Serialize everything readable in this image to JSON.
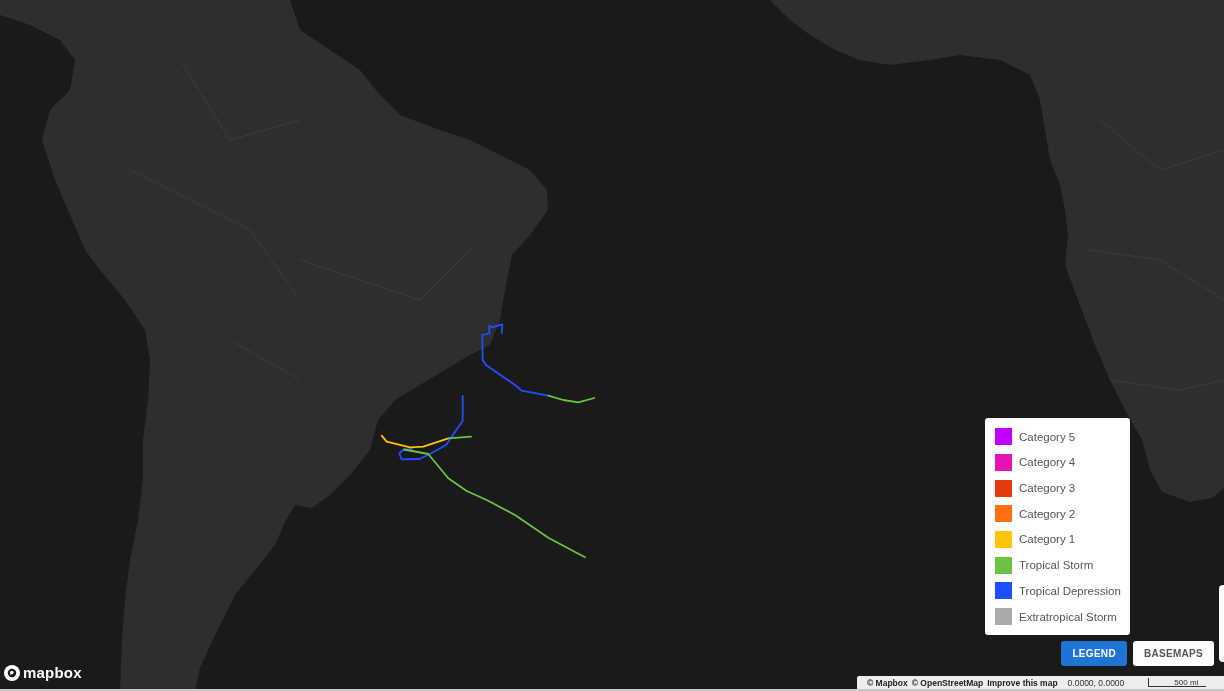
{
  "logo": {
    "text": "mapbox"
  },
  "legend": {
    "items": [
      {
        "label": "Category 5",
        "color": "#bf00ff"
      },
      {
        "label": "Category 4",
        "color": "#e614b4"
      },
      {
        "label": "Category 3",
        "color": "#e43a10"
      },
      {
        "label": "Category 2",
        "color": "#ff7010"
      },
      {
        "label": "Category 1",
        "color": "#ffc20a"
      },
      {
        "label": "Tropical Storm",
        "color": "#6cc243"
      },
      {
        "label": "Tropical Depression",
        "color": "#1f50ff"
      },
      {
        "label": "Extratropical Storm",
        "color": "#aaaaaa"
      }
    ]
  },
  "buttons": [
    {
      "label": "LEGEND",
      "selected": true
    },
    {
      "label": "BASEMAPS",
      "selected": false
    }
  ],
  "attribution": {
    "links": [
      "© Mapbox",
      "© OpenStreetMap",
      "Improve this map"
    ],
    "coordinates": "0.0000, 0.0000",
    "scale": "500 mi"
  }
}
